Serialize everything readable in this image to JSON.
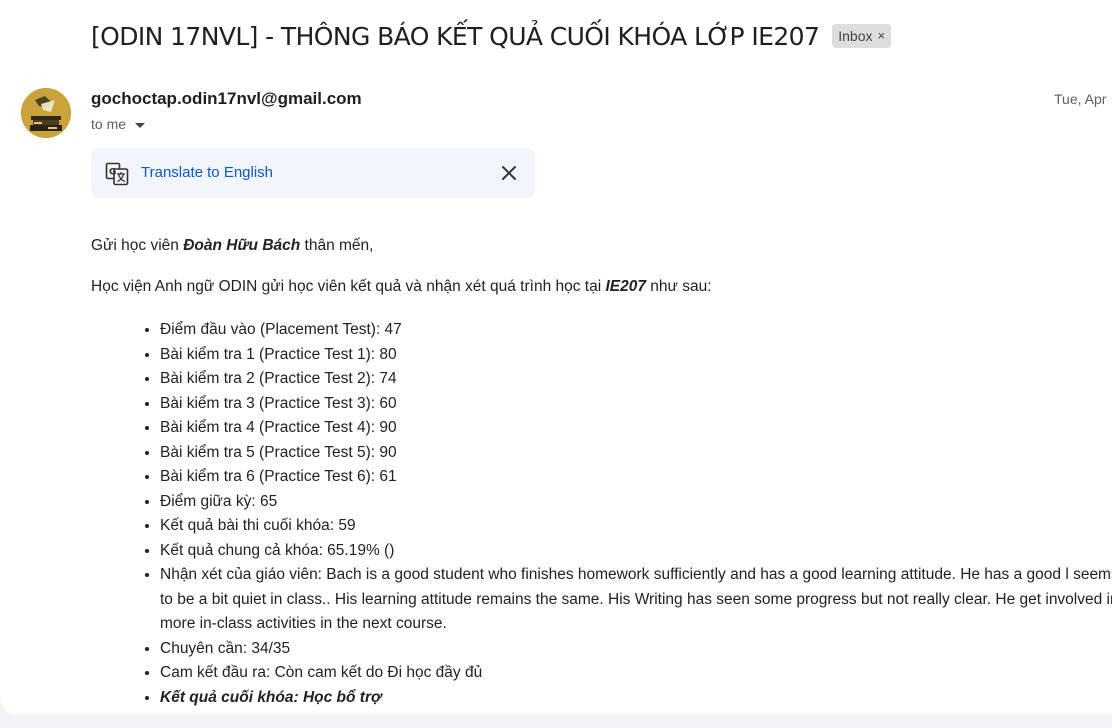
{
  "email": {
    "subject": "[ODIN 17NVL] - THÔNG BÁO KẾT QUẢ CUỐI KHÓA LỚP IE207",
    "label_chip": "Inbox",
    "label_chip_close": "×",
    "sender": "gochoctap.odin17nvl@gmail.com",
    "recipient": "to me",
    "date": "Tue, Apr"
  },
  "translate": {
    "link": "Translate to English"
  },
  "message": {
    "greet_before": "Gửi học viên ",
    "student_name": "Đoàn Hữu Bách",
    "greet_after": " thân mến,",
    "intro_before": "Học viện Anh ngữ ODIN gửi học viên kết quả và nhận xét quá trình học tại ",
    "class_code": "IE207",
    "intro_after": " như sau:",
    "results": [
      "Điểm đầu vào (Placement Test): 47",
      "Bài kiểm tra 1 (Practice Test 1): 80",
      "Bài kiểm tra 2 (Practice Test 2): 74",
      "Bài kiểm tra 3 (Practice Test 3): 60",
      "Bài kiểm tra 4 (Practice Test 4): 90",
      "Bài kiểm tra 5 (Practice Test 5): 90",
      "Bài kiểm tra 6 (Practice Test 6): 61",
      "Điểm giữa kỳ: 65",
      "Kết quả bài thi cuối khóa: 59",
      "Kết quả chung cả khóa: 65.19% ()"
    ],
    "teacher_comment": "Nhận xét của giáo viên: Bach is a good student who finishes homework sufficiently and has a good learning attitude. He has a good l seems to be a bit quiet in class.. His learning attitude remains the same. His Writing has seen some progress but not really clear. He get involved in more in-class activities in the next course.",
    "attendance": "Chuyên cần: 34/35",
    "commitment": "Cam kết đầu ra: Còn cam kết do Đi học đầy đủ",
    "final_result": "Kết quả cuối khóa: Học bổ trợ"
  }
}
